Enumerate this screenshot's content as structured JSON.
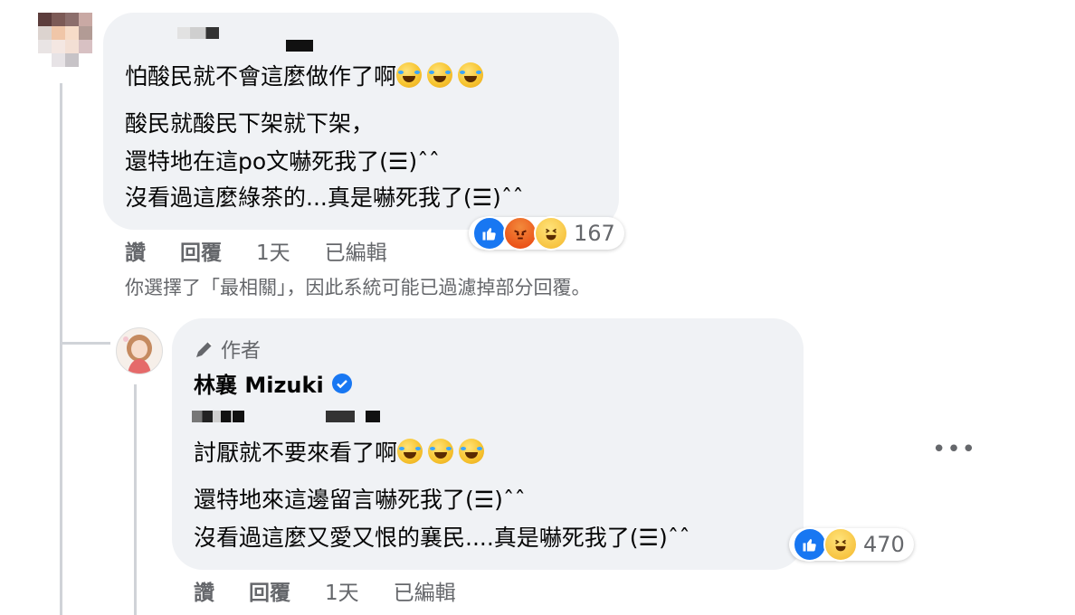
{
  "comment1": {
    "lines": [
      "怕酸民就不會這麼做作了啊",
      "酸民就酸民下架就下架，",
      "還特地在這po文嚇死我了(☰)ˆˆ",
      "沒看過這麼綠茶的...真是嚇死我了(☰)ˆˆ"
    ],
    "reaction_count": "167",
    "actions": {
      "like": "讚",
      "reply": "回覆",
      "time": "1天",
      "edited": "已編輯"
    },
    "reactions": [
      "like",
      "angry",
      "haha"
    ]
  },
  "filter_note": "你選擇了「最相關」，因此系統可能已過濾掉部分回覆。",
  "reply": {
    "badge_label": "作者",
    "author_name": "林襄 Mizuki",
    "lines": [
      "討厭就不要來看了啊",
      "還特地來這邊留言嚇死我了(☰)ˆˆ",
      "沒看過這麼又愛又恨的襄民....真是嚇死我了(☰)ˆˆ"
    ],
    "reaction_count": "470",
    "actions": {
      "like": "讚",
      "reply": "回覆",
      "time": "1天",
      "edited": "已編輯"
    },
    "reactions": [
      "like",
      "haha"
    ]
  },
  "more_menu": "•••",
  "colors": {
    "bubble": "#f0f2f5",
    "meta_text": "#65676b",
    "like_blue": "#1877f2",
    "verified_blue": "#1877f2"
  }
}
